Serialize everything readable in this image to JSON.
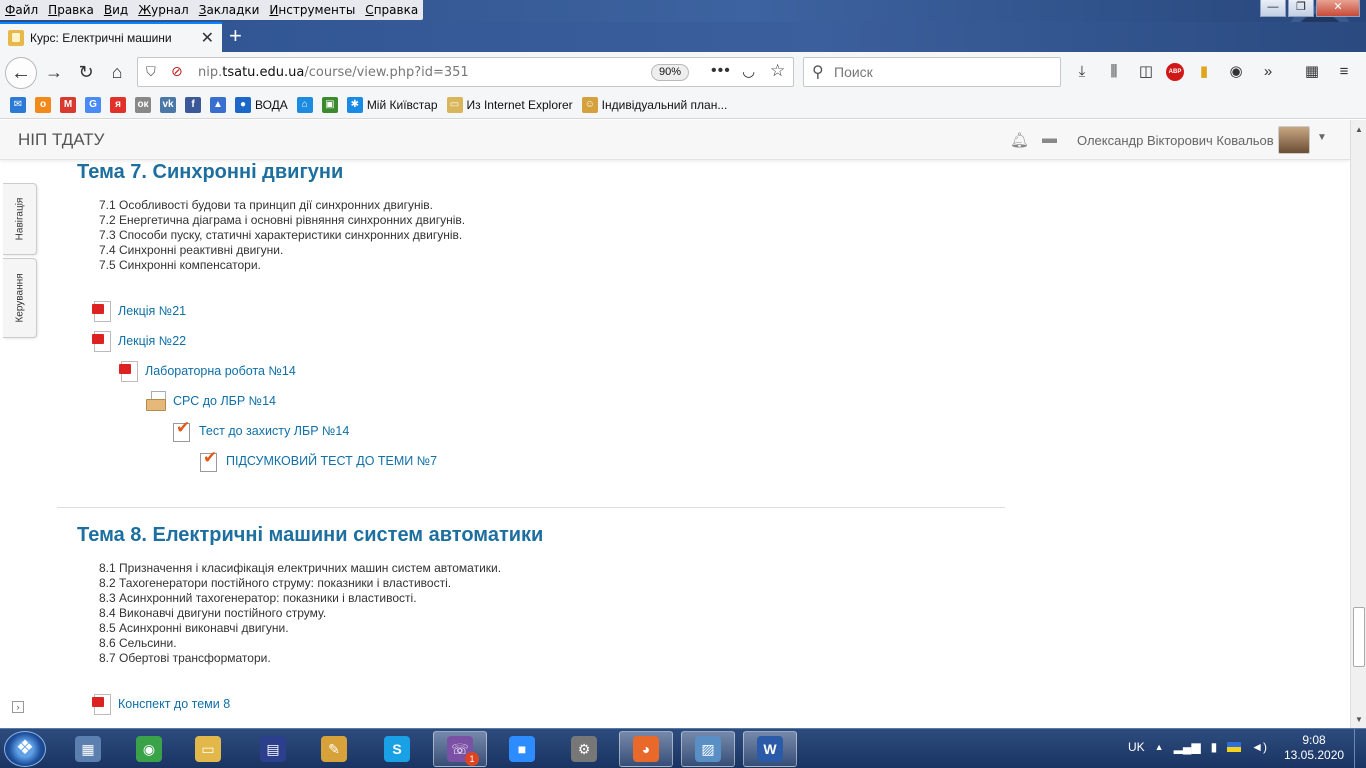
{
  "browser": {
    "menu": [
      "Файл",
      "Правка",
      "Вид",
      "Журнал",
      "Закладки",
      "Инструменты",
      "Справка"
    ],
    "window_controls": {
      "minimize": "—",
      "maximize": "❐",
      "close": "✕"
    },
    "tab_title": "Курс: Електричні машини",
    "new_tab": "+",
    "url_dim_prefix": "nip.",
    "url_host": "tsatu.edu.ua",
    "url_path": "/course/view.php?id=351",
    "zoom": "90%",
    "search_placeholder": "Поиск",
    "bookmarks": [
      {
        "label": "",
        "icon": "mail-icon",
        "color": "#2a7ad6",
        "glyph": "✉"
      },
      {
        "label": "",
        "icon": "odnoklassniki-icon",
        "color": "#f28a1b",
        "glyph": "о"
      },
      {
        "label": "",
        "icon": "gmail-icon",
        "color": "#d93a2f",
        "glyph": "M"
      },
      {
        "label": "",
        "icon": "google-icon",
        "color": "#4a8af4",
        "glyph": "G"
      },
      {
        "label": "",
        "icon": "yandex-icon",
        "color": "#e0322a",
        "glyph": "я"
      },
      {
        "label": "",
        "icon": "ok-text-icon",
        "color": "#888888",
        "glyph": "ок"
      },
      {
        "label": "",
        "icon": "vk-icon",
        "color": "#4a76a8",
        "glyph": "vk"
      },
      {
        "label": "",
        "icon": "facebook-icon",
        "color": "#3b5998",
        "glyph": "f"
      },
      {
        "label": "",
        "icon": "graduation-cap-icon",
        "color": "#3a6fd0",
        "glyph": "▲"
      },
      {
        "label": "ВОДА",
        "icon": "water-drop-icon",
        "color": "#1b68c9",
        "glyph": "●"
      },
      {
        "label": "",
        "icon": "blue-house-icon",
        "color": "#1d8be0",
        "glyph": "⌂"
      },
      {
        "label": "",
        "icon": "green-app-icon",
        "color": "#3c8a2e",
        "glyph": "▣"
      },
      {
        "label": "Мій Київстар",
        "icon": "kyivstar-icon",
        "color": "#1a8be5",
        "glyph": "✱"
      },
      {
        "label": "Из Internet Explorer",
        "icon": "folder-icon",
        "color": "#d9b55b",
        "glyph": "▭"
      },
      {
        "label": "Індивідуальний план...",
        "icon": "people-icon",
        "color": "#d4a13d",
        "glyph": "☺"
      }
    ]
  },
  "site": {
    "brand": "НІП ТДАТУ",
    "user_name": "Олександр Вікторович Ковальов",
    "side_tabs": [
      "Навігація",
      "Керування"
    ]
  },
  "section7": {
    "title": "Тема 7. Синхронні двигуни",
    "toc": [
      "7.1 Особливості будови та принцип дії синхронних двигунів.",
      "7.2 Енергетична діаграма і основні рівняння синхронних двигунів.",
      "7.3 Способи пуску, статичні характеристики синхронних двигунів.",
      "7.4 Синхронні реактивні двигуни.",
      "7.5 Синхронні компенсатори."
    ],
    "activities": [
      {
        "label": "Лекція №21",
        "icon": "pdf-icon"
      },
      {
        "label": "Лекція №22",
        "icon": "pdf-icon"
      },
      {
        "label": "Лабораторна робота №14",
        "icon": "pdf-icon"
      },
      {
        "label": "СРС до ЛБР №14",
        "icon": "folder-icon"
      },
      {
        "label": "Тест до захисту ЛБР №14",
        "icon": "quiz-icon"
      },
      {
        "label": "ПІДСУМКОВИЙ ТЕСТ ДО ТЕМИ №7",
        "icon": "quiz-icon"
      }
    ]
  },
  "section8": {
    "title": "Тема 8. Електричні машини систем автоматики",
    "toc": [
      "8.1 Призначення і класифікація електричних машин систем автоматики.",
      "8.2 Тахогенератори постійного струму: показники і властивості.",
      "8.3 Асинхронний тахогенератор: показники і властивості.",
      "8.4 Виконавчі двигуни постійного струму.",
      "8.5 Асинхронні виконавчі двигуни.",
      "8.6 Сельсини.",
      "8.7 Обертові трансформатори."
    ],
    "activities": [
      {
        "label": "Конспект до теми 8",
        "icon": "pdf-icon"
      }
    ]
  },
  "taskbar": {
    "apps": [
      {
        "name": "calculator",
        "color": "#5b7fae",
        "glyph": "▦"
      },
      {
        "name": "chrome",
        "color": "#3aa34a",
        "glyph": "◉"
      },
      {
        "name": "explorer",
        "color": "#e2b84a",
        "glyph": "▭"
      },
      {
        "name": "floppy",
        "color": "#2b3f8c",
        "glyph": "▤"
      },
      {
        "name": "paint",
        "color": "#d8a23a",
        "glyph": "✎"
      },
      {
        "name": "skype",
        "color": "#1aa0e5",
        "glyph": "S"
      },
      {
        "name": "viber",
        "color": "#7b51a6",
        "glyph": "☏"
      },
      {
        "name": "zoom",
        "color": "#2d8cff",
        "glyph": "■"
      },
      {
        "name": "network-tool",
        "color": "#777777",
        "glyph": "⚙"
      },
      {
        "name": "firefox",
        "color": "#e8692a",
        "glyph": "◕"
      },
      {
        "name": "photos",
        "color": "#5a8fc5",
        "glyph": "▨"
      },
      {
        "name": "word",
        "color": "#2b5aa8",
        "glyph": "W"
      }
    ],
    "viber_badge": "1",
    "lang": "UK",
    "time": "9:08",
    "date": "13.05.2020"
  }
}
